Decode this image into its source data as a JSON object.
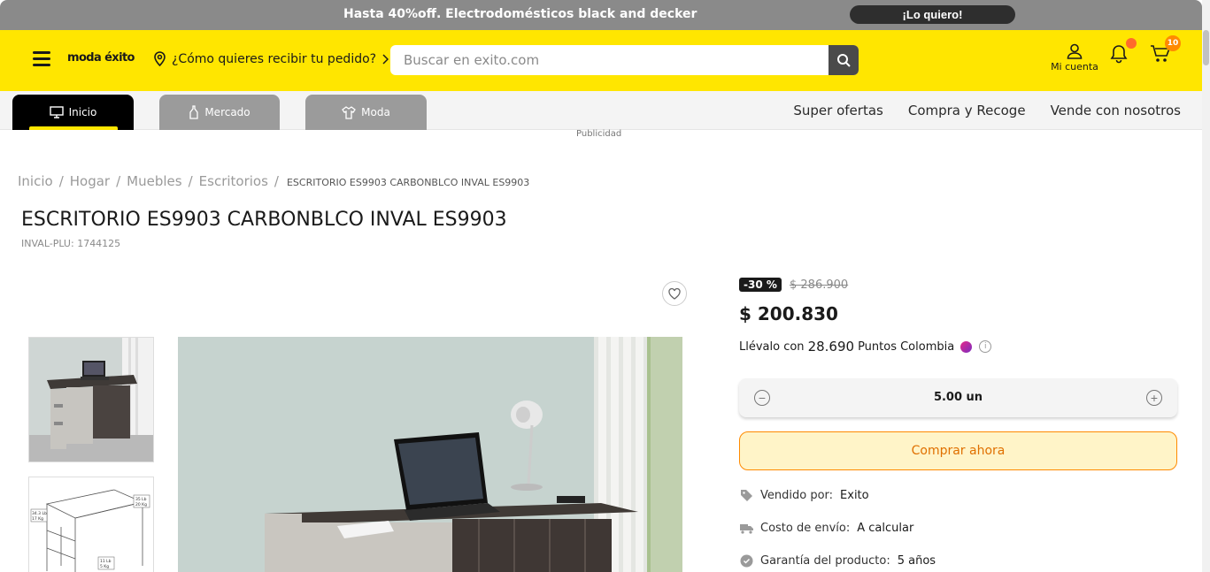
{
  "promo": {
    "text": "Hasta 40%off. Electrodomésticos black and decker",
    "cta": "¡Lo quiero!"
  },
  "header": {
    "logo": "moda éxito",
    "delivery_prompt": "¿Cómo quieres recibir tu pedido?",
    "search_placeholder": "Buscar en exito.com",
    "account_label": "Mi cuenta",
    "cart_count": "10",
    "brand_color": "#ffe600"
  },
  "nav": {
    "tabs": [
      {
        "label": "Inicio",
        "icon": "monitor-icon",
        "active": true
      },
      {
        "label": "Mercado",
        "icon": "bottle-icon",
        "active": false
      },
      {
        "label": "Moda",
        "icon": "shirt-icon",
        "active": false
      }
    ],
    "links": [
      "Super ofertas",
      "Compra y Recoge",
      "Vende con nosotros"
    ]
  },
  "ad_label": "Publicidad",
  "breadcrumb": {
    "items": [
      "Inicio",
      "Hogar",
      "Muebles",
      "Escritorios"
    ],
    "current": "ESCRITORIO ES9903 CARBONBLCO INVAL ES9903"
  },
  "product": {
    "title": "ESCRITORIO ES9903 CARBONBLCO INVAL ES9903",
    "plu": "INVAL-PLU: 1744125",
    "discount": "-30 %",
    "old_price": "$ 286.900",
    "price": "$ 200.830",
    "points_prefix": "Llévalo con",
    "points_value": "28.690",
    "points_suffix": "Puntos Colombia",
    "quantity": "5.00 un",
    "buy_label": "Comprar ahora",
    "details": [
      {
        "label": "Vendido por:",
        "value": "Exito",
        "icon": "tag-icon"
      },
      {
        "label": "Costo de envío:",
        "value": "A calcular",
        "icon": "truck-icon"
      },
      {
        "label": "Garantía del producto:",
        "value": "5 años",
        "icon": "badge-check-icon"
      }
    ],
    "accent_color": "#ff8a00"
  },
  "thumb_labels": [
    "34.3 Lb",
    "17 Kg",
    "35 Lb",
    "20 Kg",
    "11 Lb",
    "5 Kg"
  ]
}
